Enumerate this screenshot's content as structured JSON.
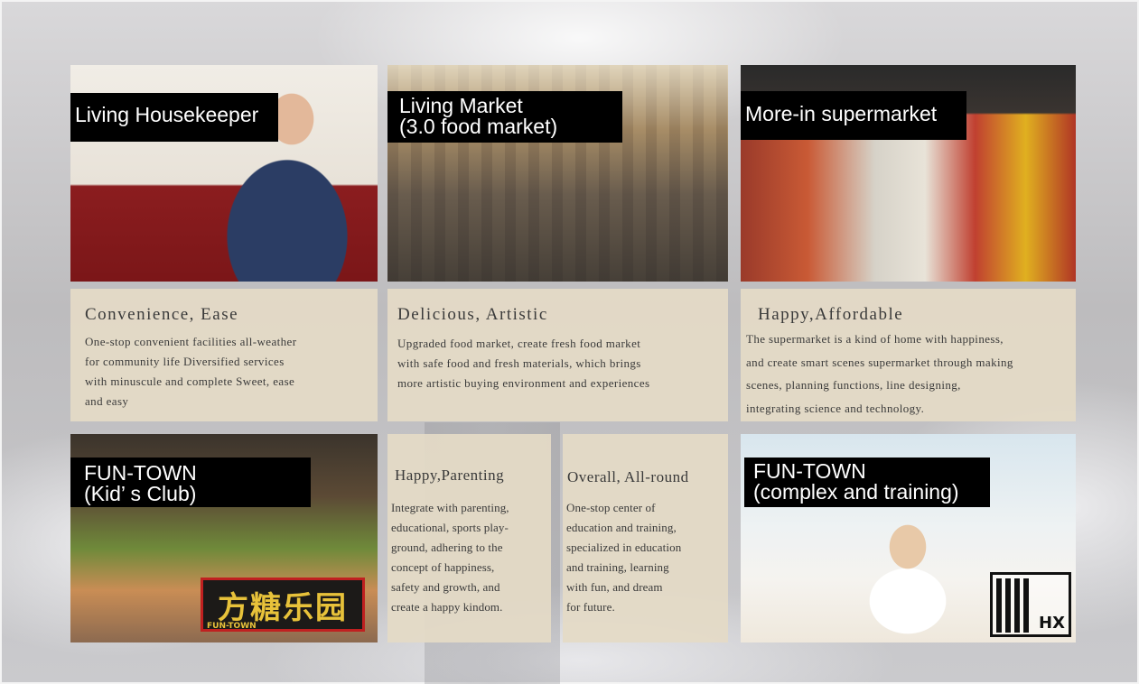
{
  "tiles": {
    "housekeeper": {
      "label": "Living Housekeeper",
      "heading": "Convenience, Ease",
      "body": "One-stop convenient facilities all-weather\nfor community life Diversified services\nwith minuscule and complete Sweet, ease\nand easy"
    },
    "market": {
      "label": "Living Market\n(3.0 food market)",
      "heading": "Delicious, Artistic",
      "body": "Upgraded food market, create fresh food market\nwith safe food and fresh materials, which brings\nmore artistic buying environment and experiences"
    },
    "supermarket": {
      "label": "More-in supermarket",
      "heading": "Happy,Affordable",
      "body": "The supermarket is a kind of home with happiness,\nand create smart scenes supermarket through making\nscenes, planning functions, line designing,\nintegrating science and technology."
    },
    "kidsclub": {
      "label": "FUN-TOWN\n(Kid’ s Club)",
      "logo_text": "方糖乐园",
      "logo_sub": "FUN-TOWN"
    },
    "parenting": {
      "heading": "Happy,Parenting",
      "body": "Integrate with parenting,\neducational, sports play-\nground, adhering to the\nconcept of happiness,\nsafety and growth, and\ncreate a happy kindom."
    },
    "allround": {
      "heading": "Overall, All-round",
      "body": "One-stop center of\neducation and training,\nspecialized in education\nand training, learning\nwith fun, and dream\nfor future."
    },
    "training": {
      "label": "FUN-TOWN\n(complex and training)",
      "logo_text": "HX"
    }
  },
  "colors": {
    "label_bg": "#000000",
    "label_text": "#ffffff",
    "card_bg": "#e4dac6",
    "card_text": "#3a3a3a"
  }
}
